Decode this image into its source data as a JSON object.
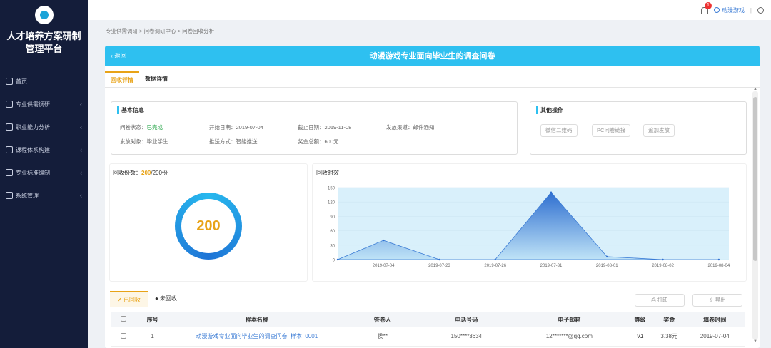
{
  "sidebar": {
    "brand_line1": "人才培养方案研制",
    "brand_line2": "管理平台",
    "items": [
      {
        "label": "首页"
      },
      {
        "label": "专业供需调研"
      },
      {
        "label": "职业能力分析"
      },
      {
        "label": "课程体系构建"
      },
      {
        "label": "专业标准编制"
      },
      {
        "label": "系统管理"
      }
    ]
  },
  "topbar": {
    "badge": "1",
    "user": "动漫游戏",
    "sep": "|"
  },
  "breadcrumb": "专业供需调研 > 问卷调研中心 > 问卷回收分析",
  "panel": {
    "back": "返回",
    "title": "动漫游戏专业面向毕业生的调查问卷"
  },
  "tabs": [
    "回收详情",
    "数据详情"
  ],
  "basic": {
    "title": "基本信息",
    "status_label": "问卷状态：",
    "status_value": "已完成",
    "start": "开始日期：2019-07-04",
    "end": "截止日期：2019-11-08",
    "channel": "发放渠道：邮件通知",
    "target": "发放对象：毕业学生",
    "push": "推送方式：智能推送",
    "reward": "奖金总额：600元"
  },
  "other": {
    "title": "其他操作",
    "btn_wechat": "微信二维码",
    "btn_pc": "PC问卷链接",
    "btn_add": "追加发放"
  },
  "recv": {
    "label": "回收份数：",
    "count": "200",
    "total": "/200份",
    "donut": "200"
  },
  "chart_data": {
    "type": "area",
    "title": "回收时效",
    "x": [
      "2019-07-04",
      "2019-07-23",
      "2019-07-26",
      "2019-07-31",
      "2019-08-01",
      "2019-08-02",
      "2019-08-04"
    ],
    "points": [
      {
        "x": "2019-07-01",
        "y": 0
      },
      {
        "x": "2019-07-04",
        "y": 40
      },
      {
        "x": "2019-07-23",
        "y": 0
      },
      {
        "x": "2019-07-26",
        "y": 0
      },
      {
        "x": "2019-07-31",
        "y": 140
      },
      {
        "x": "2019-08-01",
        "y": 6
      },
      {
        "x": "2019-08-02",
        "y": 0
      },
      {
        "x": "2019-08-04",
        "y": 0
      }
    ],
    "yticks": [
      0,
      30,
      60,
      90,
      120,
      150
    ],
    "ylim": [
      0,
      150
    ],
    "colors": {
      "fill_top": "#2f6fd0",
      "fill_bottom": "#bfe3f7",
      "plot_bg": "#d9f0fb"
    }
  },
  "subtabs": [
    "已回收",
    "未回收"
  ],
  "actions": {
    "print": "打印",
    "export": "导出"
  },
  "table": {
    "headers": [
      "序号",
      "样本名称",
      "答卷人",
      "电话号码",
      "电子邮箱",
      "等级",
      "奖金",
      "填卷时间"
    ],
    "rows": [
      {
        "no": "1",
        "name": "动漫游戏专业面向毕业生的调查问卷_样本_0001",
        "person": "侯**",
        "phone": "150****3634",
        "email": "12*******@qq.com",
        "level": "V1",
        "bonus": "3.38元",
        "time": "2019-07-04"
      }
    ]
  }
}
